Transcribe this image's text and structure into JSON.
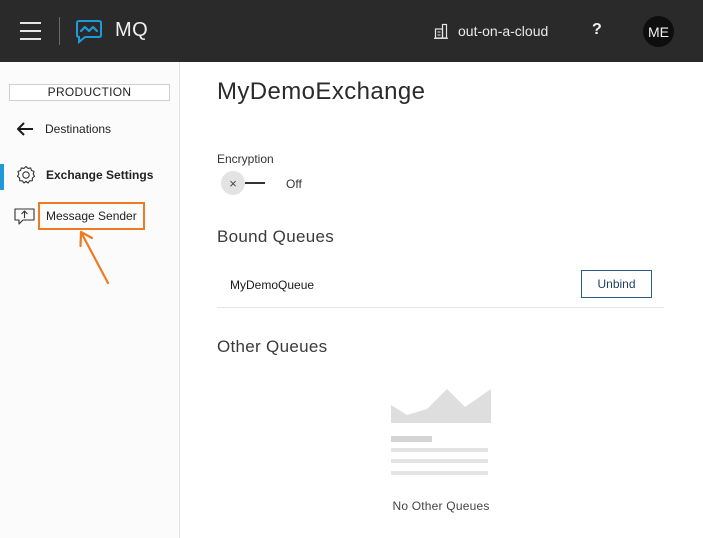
{
  "header": {
    "app_name": "MQ",
    "cloud_name": "out-on-a-cloud",
    "help_label": "?",
    "user_initials": "ME",
    "colors": {
      "bar": "#2a2a2a",
      "logo_accent": "#1f9ad6"
    },
    "icons": {
      "menu": "hamburger-icon",
      "logo": "mq-logo-icon",
      "cloud": "cloud-building-icon"
    }
  },
  "sidebar": {
    "environment": "PRODUCTION",
    "back_label": "Destinations",
    "items": [
      {
        "label": "Exchange Settings",
        "icon": "gear-icon",
        "active": true
      },
      {
        "label": "Message Sender",
        "icon": "send-message-icon",
        "active": false,
        "highlighted": true
      }
    ],
    "colors": {
      "active_indicator": "#1f9ad6",
      "highlight": "#ef7a1f"
    }
  },
  "main": {
    "title": "MyDemoExchange",
    "encryption": {
      "label": "Encryption",
      "toggle_symbol": "×",
      "state": "Off"
    },
    "bound_queues": {
      "title": "Bound Queues",
      "rows": [
        {
          "name": "MyDemoQueue",
          "action": "Unbind"
        }
      ]
    },
    "other_queues": {
      "title": "Other Queues",
      "empty_text": "No Other Queues"
    }
  }
}
